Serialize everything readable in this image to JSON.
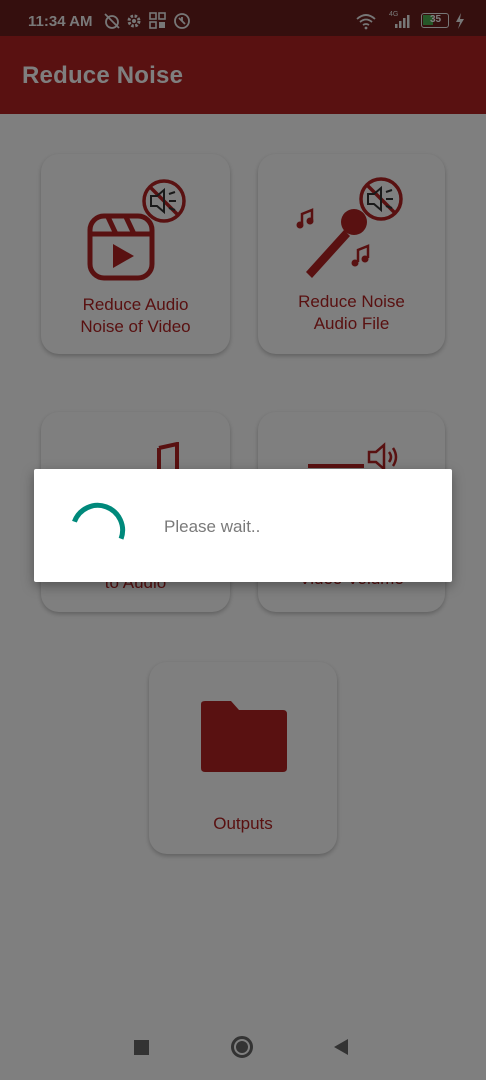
{
  "status_bar": {
    "time": "11:34 AM",
    "battery_level": "35",
    "network": "4G"
  },
  "app_bar": {
    "title": "Reduce Noise"
  },
  "menu": {
    "reduce_video_noise": {
      "line1": "Reduce Audio",
      "line2": "Noise of Video"
    },
    "reduce_audio_noise": {
      "line1": "Reduce Noise",
      "line2": "Audio File"
    },
    "video_to_audio": {
      "line1": "to Audio"
    },
    "video_volume": {
      "line1": "Video Volume"
    },
    "outputs": {
      "label": "Outputs"
    }
  },
  "dialog": {
    "message": "Please wait.."
  },
  "colors": {
    "accent": "#b22222",
    "statusbar": "#6b1f1c",
    "spinner": "#00897b"
  },
  "icons": [
    "alarm-off-icon",
    "settings-icon",
    "apps-icon",
    "vpn-icon",
    "wifi-icon",
    "signal-icon",
    "battery-icon",
    "charging-icon"
  ]
}
